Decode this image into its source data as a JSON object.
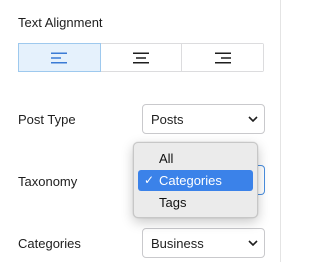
{
  "text_alignment": {
    "label": "Text Alignment",
    "options": [
      {
        "name": "align-left",
        "active": true
      },
      {
        "name": "align-center",
        "active": false
      },
      {
        "name": "align-right",
        "active": false
      }
    ],
    "active_color": "#e5f1fc"
  },
  "post_type": {
    "label": "Post Type",
    "value": "Posts"
  },
  "taxonomy": {
    "label": "Taxonomy",
    "options": [
      "All",
      "Categories",
      "Tags"
    ],
    "selected": "Categories",
    "check_mark": "✓"
  },
  "categories": {
    "label": "Categories",
    "value": "Business"
  },
  "colors": {
    "selection_blue": "#3b82e9",
    "text": "#1e1e1e"
  }
}
